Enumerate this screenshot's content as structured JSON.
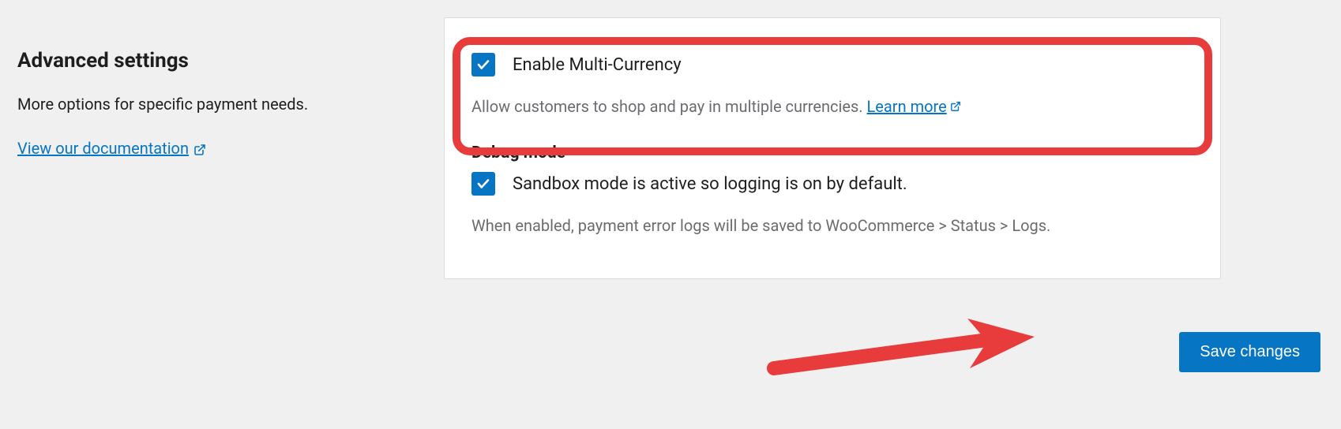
{
  "left": {
    "title": "Advanced settings",
    "description": "More options for specific payment needs.",
    "doc_link": "View our documentation"
  },
  "panel": {
    "multi_currency": {
      "label": "Enable Multi-Currency",
      "description": "Allow customers to shop and pay in multiple currencies.",
      "learn_more": "Learn more"
    },
    "debug": {
      "heading": "Debug mode",
      "label": "Sandbox mode is active so logging is on by default.",
      "description": "When enabled, payment error logs will be saved to WooCommerce > Status > Logs."
    }
  },
  "actions": {
    "save": "Save changes"
  }
}
